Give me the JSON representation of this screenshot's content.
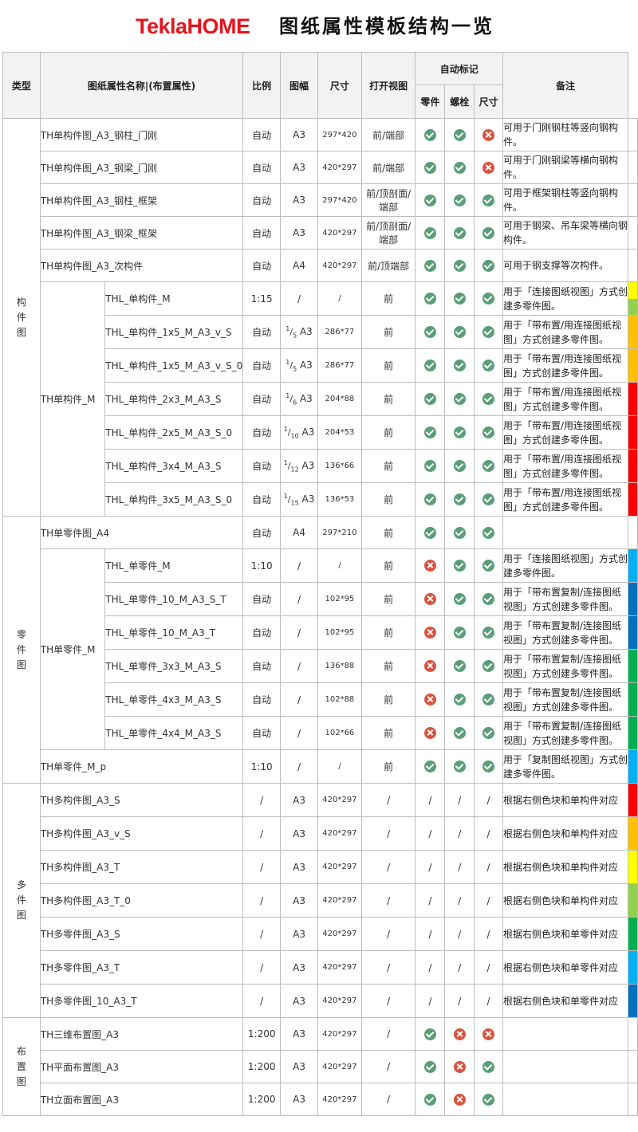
{
  "header": {
    "brand": "TeklaHOME",
    "title": "图纸属性模板结构一览"
  },
  "columns": {
    "type": "类型",
    "name": "图纸属性名称|(布置属性)",
    "ratio": "比例",
    "format": "图幅",
    "size": "尺寸",
    "view": "打开视图",
    "auto": "自动标记",
    "part": "零件",
    "bolt": "螺栓",
    "dim": "尺寸",
    "note": "备注"
  },
  "symbols": {
    "yes": "check-icon",
    "no": "cross-icon"
  },
  "colors": {
    "yellow": "#ffff00",
    "lightgreen": "#92d050",
    "orange": "#ffc000",
    "red": "#ff0000",
    "lightblue": "#00b0f0",
    "blue": "#0070c0",
    "green": "#00b050"
  },
  "sections": [
    {
      "type": "构件图",
      "rows": [
        {
          "group": "",
          "name": "TH单构件图_A3_钢柱_门刚",
          "ratio": "自动",
          "format": "A3",
          "size": "297*420",
          "view": "前/端部",
          "part": true,
          "bolt": true,
          "dim": false,
          "note": "可用于门刚钢柱等竖向钢构件。",
          "color": ""
        },
        {
          "group": "",
          "name": "TH单构件图_A3_钢梁_门刚",
          "ratio": "自动",
          "format": "A3",
          "size": "420*297",
          "view": "前/端部",
          "part": true,
          "bolt": true,
          "dim": false,
          "note": "可用于门刚钢梁等横向钢构件。",
          "color": ""
        },
        {
          "group": "",
          "name": "TH单构件图_A3_钢柱_框架",
          "ratio": "自动",
          "format": "A3",
          "size": "297*420",
          "view": "前/顶剖面/端部",
          "part": true,
          "bolt": true,
          "dim": true,
          "note": "可用于框架钢柱等竖向钢构件。",
          "color": ""
        },
        {
          "group": "",
          "name": "TH单构件图_A3_钢梁_框架",
          "ratio": "自动",
          "format": "A3",
          "size": "420*297",
          "view": "前/顶剖面/端部",
          "part": true,
          "bolt": true,
          "dim": true,
          "note": "可用于钢梁、吊车梁等横向钢构件。",
          "color": ""
        },
        {
          "group": "",
          "name": "TH单构件图_A3_次构件",
          "ratio": "自动",
          "format": "A4",
          "size": "420*297",
          "view": "前/顶端部",
          "part": true,
          "bolt": true,
          "dim": true,
          "note": "可用于钢支撑等次构件。",
          "color": ""
        },
        {
          "group": "TH单构件_M",
          "name": "THL_单构件_M",
          "ratio": "1:15",
          "format": "/",
          "format_num": "",
          "format_den": "",
          "size": "/",
          "view": "前",
          "part": true,
          "bolt": true,
          "dim": true,
          "note": "用于「连接图纸视图」方式创建多零件图。",
          "color": "#ffff00|#92d050"
        },
        {
          "group": "TH单构件_M",
          "name": "THL_单构件_1x5_M_A3_v_S",
          "ratio": "自动",
          "format": "A3",
          "format_num": "1",
          "format_den": "5",
          "size": "286*77",
          "view": "前",
          "part": true,
          "bolt": true,
          "dim": true,
          "note": "用于「带布置/用连接图纸视图」方式创建多零件图。",
          "color": "#ffc000"
        },
        {
          "group": "TH单构件_M",
          "name": "THL_单构件_1x5_M_A3_v_S_0",
          "ratio": "自动",
          "format": "A3",
          "format_num": "1",
          "format_den": "5",
          "size": "286*77",
          "view": "前",
          "part": true,
          "bolt": true,
          "dim": true,
          "note": "用于「带布置/用连接图纸视图」方式创建多零件图。",
          "color": "#ffc000"
        },
        {
          "group": "TH单构件_M",
          "name": "THL_单构件_2x3_M_A3_S",
          "ratio": "自动",
          "format": "A3",
          "format_num": "1",
          "format_den": "6",
          "size": "204*88",
          "view": "前",
          "part": true,
          "bolt": true,
          "dim": true,
          "note": "用于「带布置/用连接图纸视图」方式创建多零件图。",
          "color": "#ff0000"
        },
        {
          "group": "TH单构件_M",
          "name": "THL_单构件_2x5_M_A3_S_0",
          "ratio": "自动",
          "format": "A3",
          "format_num": "1",
          "format_den": "10",
          "size": "204*53",
          "view": "前",
          "part": true,
          "bolt": true,
          "dim": true,
          "note": "用于「带布置/用连接图纸视图」方式创建多零件图。",
          "color": "#ff0000"
        },
        {
          "group": "TH单构件_M",
          "name": "THL_单构件_3x4_M_A3_S",
          "ratio": "自动",
          "format": "A3",
          "format_num": "1",
          "format_den": "12",
          "size": "136*66",
          "view": "前",
          "part": true,
          "bolt": true,
          "dim": true,
          "note": "用于「带布置/用连接图纸视图」方式创建多零件图。",
          "color": "#ff0000"
        },
        {
          "group": "TH单构件_M",
          "name": "THL_单构件_3x5_M_A3_S_0",
          "ratio": "自动",
          "format": "A3",
          "format_num": "1",
          "format_den": "15",
          "size": "136*53",
          "view": "前",
          "part": true,
          "bolt": true,
          "dim": true,
          "note": "用于「带布置/用连接图纸视图」方式创建多零件图。",
          "color": "#ff0000"
        }
      ]
    },
    {
      "type": "零件图",
      "rows": [
        {
          "group": "",
          "name": "TH单零件图_A4",
          "ratio": "自动",
          "format": "A4",
          "size": "297*210",
          "view": "前",
          "part": true,
          "bolt": true,
          "dim": true,
          "note": "",
          "color": ""
        },
        {
          "group": "TH单零件_M",
          "name": "THL_单零件_M",
          "ratio": "1:10",
          "format": "/",
          "size": "/",
          "view": "前",
          "part": false,
          "bolt": true,
          "dim": true,
          "note": "用于「连接图纸视图」方式创建多零件图。",
          "color": "#00b0f0"
        },
        {
          "group": "TH单零件_M",
          "name": "THL_单零件_10_M_A3_S_T",
          "ratio": "自动",
          "format": "/",
          "size": "102*95",
          "view": "前",
          "part": false,
          "bolt": true,
          "dim": true,
          "note": "用于「带布置复制/连接图纸视图」方式创建多零件图。",
          "color": "#0070c0"
        },
        {
          "group": "TH单零件_M",
          "name": "THL_单零件_10_M_A3_T",
          "ratio": "自动",
          "format": "/",
          "size": "102*95",
          "view": "前",
          "part": false,
          "bolt": true,
          "dim": true,
          "note": "用于「带布置复制/连接图纸视图」方式创建多零件图。",
          "color": "#0070c0"
        },
        {
          "group": "TH单零件_M",
          "name": "THL_单零件_3x3_M_A3_S",
          "ratio": "自动",
          "format": "/",
          "size": "136*88",
          "view": "前",
          "part": false,
          "bolt": true,
          "dim": true,
          "note": "用于「带布置复制/连接图纸视图」方式创建多零件图。",
          "color": "#00b050"
        },
        {
          "group": "TH单零件_M",
          "name": "THL_单零件_4x3_M_A3_S",
          "ratio": "自动",
          "format": "/",
          "size": "102*88",
          "view": "前",
          "part": false,
          "bolt": true,
          "dim": true,
          "note": "用于「带布置复制/连接图纸视图」方式创建多零件图。",
          "color": "#00b050"
        },
        {
          "group": "TH单零件_M",
          "name": "THL_单零件_4x4_M_A3_S",
          "ratio": "自动",
          "format": "/",
          "size": "102*66",
          "view": "前",
          "part": false,
          "bolt": true,
          "dim": true,
          "note": "用于「带布置复制/连接图纸视图」方式创建多零件图。",
          "color": "#00b050"
        },
        {
          "group": "",
          "name": "TH单零件_M_p",
          "ratio": "1:10",
          "format": "/",
          "size": "/",
          "view": "前",
          "part": true,
          "bolt": true,
          "dim": true,
          "note": "用于「复制图纸视图」方式创建多零件图。",
          "color": "#00b0f0"
        }
      ]
    },
    {
      "type": "多件图",
      "rows": [
        {
          "group": "",
          "name": "TH多构件图_A3_S",
          "ratio": "/",
          "format": "A3",
          "size": "420*297",
          "view": "/",
          "part": "/",
          "bolt": "/",
          "dim": "/",
          "note": "根据右侧色块和单构件对应",
          "color": "#ff0000"
        },
        {
          "group": "",
          "name": "TH多构件图_A3_v_S",
          "ratio": "/",
          "format": "A3",
          "size": "420*297",
          "view": "/",
          "part": "/",
          "bolt": "/",
          "dim": "/",
          "note": "根据右侧色块和单构件对应",
          "color": "#ffc000"
        },
        {
          "group": "",
          "name": "TH多构件图_A3_T",
          "ratio": "/",
          "format": "A3",
          "size": "420*297",
          "view": "/",
          "part": "/",
          "bolt": "/",
          "dim": "/",
          "note": "根据右侧色块和单构件对应",
          "color": "#ffff00"
        },
        {
          "group": "",
          "name": "TH多构件图_A3_T_0",
          "ratio": "/",
          "format": "A3",
          "size": "420*297",
          "view": "/",
          "part": "/",
          "bolt": "/",
          "dim": "/",
          "note": "根据右侧色块和单构件对应",
          "color": "#92d050"
        },
        {
          "group": "",
          "name": "TH多零件图_A3_S",
          "ratio": "/",
          "format": "A3",
          "size": "420*297",
          "view": "/",
          "part": "/",
          "bolt": "/",
          "dim": "/",
          "note": "根据右侧色块和单零件对应",
          "color": "#00b050"
        },
        {
          "group": "",
          "name": "TH多零件图_A3_T",
          "ratio": "/",
          "format": "A3",
          "size": "420*297",
          "view": "/",
          "part": "/",
          "bolt": "/",
          "dim": "/",
          "note": "根据右侧色块和单零件对应",
          "color": "#00b0f0"
        },
        {
          "group": "",
          "name": "TH多零件图_10_A3_T",
          "ratio": "/",
          "format": "A3",
          "size": "420*297",
          "view": "/",
          "part": "/",
          "bolt": "/",
          "dim": "/",
          "note": "根据右侧色块和单零件对应",
          "color": "#0070c0"
        }
      ]
    },
    {
      "type": "布置图",
      "rows": [
        {
          "group": "",
          "name": "TH三维布置图_A3",
          "ratio": "1:200",
          "format": "A3",
          "size": "420*297",
          "view": "/",
          "part": true,
          "bolt": false,
          "dim": false,
          "note": "",
          "color": ""
        },
        {
          "group": "",
          "name": "TH平面布置图_A3",
          "ratio": "1:200",
          "format": "A3",
          "size": "420*297",
          "view": "/",
          "part": true,
          "bolt": false,
          "dim": true,
          "note": "",
          "color": ""
        },
        {
          "group": "",
          "name": "TH立面布置图_A3",
          "ratio": "1:200",
          "format": "A3",
          "size": "420*297",
          "view": "/",
          "part": true,
          "bolt": false,
          "dim": true,
          "note": "",
          "color": ""
        }
      ]
    }
  ]
}
